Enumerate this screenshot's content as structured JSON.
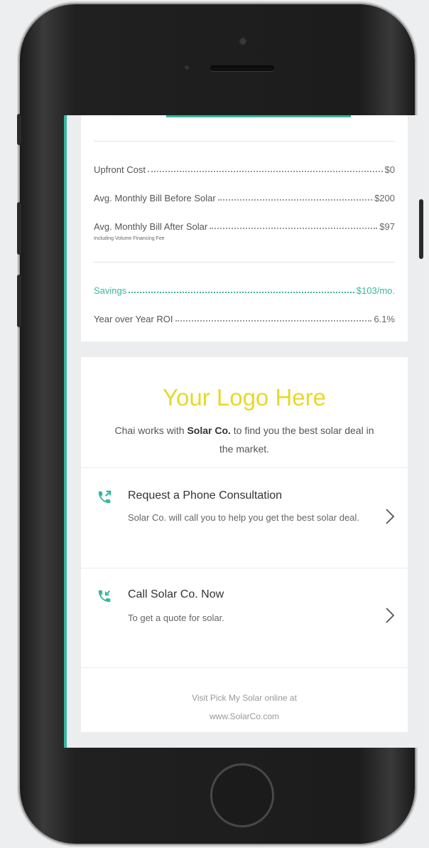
{
  "summary": {
    "rows": [
      {
        "label": "Upfront Cost",
        "value": "$0"
      },
      {
        "label": "Avg. Monthly Bill Before Solar",
        "value": "$200"
      },
      {
        "label": "Avg. Monthly Bill After Solar",
        "value": "$97"
      }
    ],
    "after_note": "Including Volume Financing Fee",
    "savings": {
      "label": "Savings",
      "value": "$103/mo."
    },
    "roi": {
      "label": "Year over Year ROI",
      "value": "6.1%"
    }
  },
  "partner": {
    "logo_text": "Your Logo Here",
    "text_before": "Chai works with ",
    "company": "Solar Co.",
    "text_after": " to find you the best solar deal in the market."
  },
  "actions": [
    {
      "title": "Request a Phone Consultation",
      "description": "Solar Co. will call you to help you get the best solar deal.",
      "icon": "phone-callback-icon"
    },
    {
      "title": "Call Solar Co. Now",
      "description": "To get a quote for solar.",
      "icon": "phone-outgoing-icon"
    }
  ],
  "footer": {
    "line1": "Visit Pick My Solar online at",
    "line2": "www.SolarCo.com"
  },
  "colors": {
    "accent": "#3ab59f",
    "logo": "#e8d82c"
  }
}
